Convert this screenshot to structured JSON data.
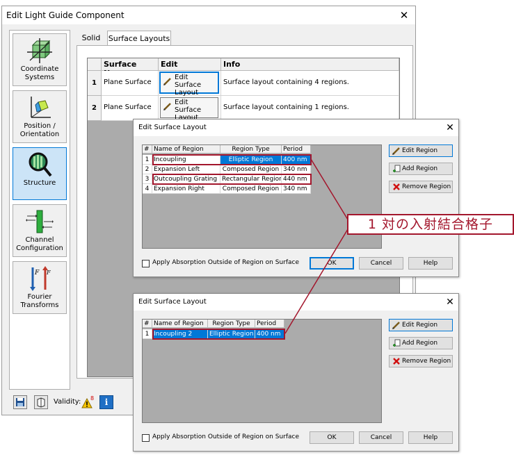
{
  "main_window": {
    "title": "Edit Light Guide Component",
    "sidebar": [
      {
        "label": "Coordinate Systems",
        "icon": "coordinate-systems-icon"
      },
      {
        "label": "Position / Orientation",
        "icon": "position-orientation-icon"
      },
      {
        "label": "Structure",
        "icon": "structure-icon"
      },
      {
        "label": "Channel Configuration",
        "icon": "channel-configuration-icon"
      },
      {
        "label": "Fourier Transforms",
        "icon": "fourier-transforms-icon"
      }
    ],
    "tabs": [
      "Solid",
      "Surface Layouts"
    ],
    "table": {
      "headers": [
        "Surface Name",
        "Edit",
        "Info"
      ],
      "rows": [
        {
          "num": "1",
          "name": "Plane Surface",
          "edit": "Edit Surface Layout",
          "info": "Surface layout containing 4 regions."
        },
        {
          "num": "2",
          "name": "Plane Surface",
          "edit": "Edit Surface Layout",
          "info": "Surface layout containing 1 regions."
        }
      ]
    },
    "status": {
      "validity_label": "Validity:",
      "warning_count": "8"
    }
  },
  "dialog1": {
    "title": "Edit Surface Layout",
    "headers": [
      "#",
      "Name of Region",
      "Region Type",
      "Period"
    ],
    "rows": [
      {
        "num": "1",
        "name": "Incoupling",
        "type": "Elliptic Region",
        "period": "400 nm"
      },
      {
        "num": "2",
        "name": "Expansion Left",
        "type": "Composed Region",
        "period": "340 nm"
      },
      {
        "num": "3",
        "name": "Outcoupling Grating",
        "type": "Rectangular Region",
        "period": "440 nm"
      },
      {
        "num": "4",
        "name": "Expansion Right",
        "type": "Composed Region",
        "period": "340 nm"
      }
    ],
    "edit_region": "Edit Region",
    "add_region": "Add Region",
    "remove_region": "Remove Region",
    "absorption": "Apply Absorption Outside of Region on Surface",
    "ok": "OK",
    "cancel": "Cancel",
    "help": "Help"
  },
  "dialog2": {
    "title": "Edit Surface Layout",
    "headers": [
      "#",
      "Name of Region",
      "Region Type",
      "Period"
    ],
    "rows": [
      {
        "num": "1",
        "name": "Incoupling 2",
        "type": "Elliptic Region",
        "period": "400 nm"
      }
    ],
    "edit_region": "Edit Region",
    "add_region": "Add Region",
    "remove_region": "Remove Region",
    "absorption": "Apply Absorption Outside of Region on Surface",
    "ok": "OK",
    "cancel": "Cancel",
    "help": "Help"
  },
  "callout": "1 対の入射結合格子",
  "colors": {
    "accent": "#0078d7",
    "highlight": "#a3162c"
  }
}
